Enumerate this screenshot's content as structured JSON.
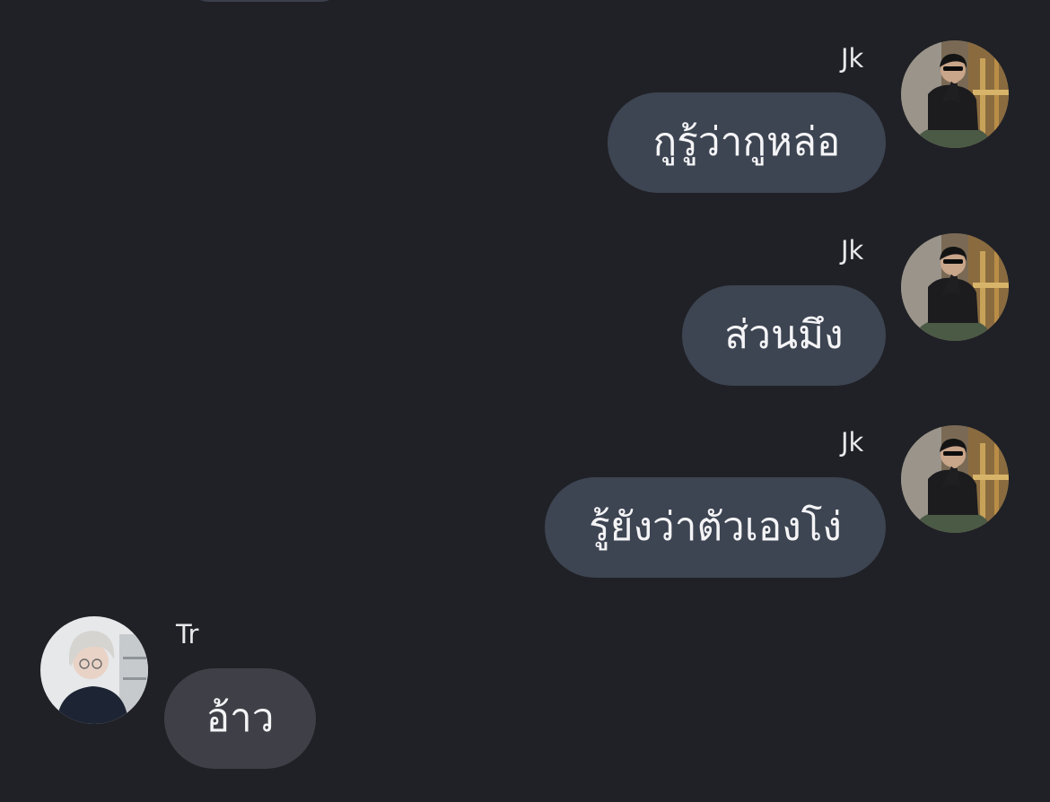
{
  "chat": {
    "messages": [
      {
        "sender": "Jk",
        "text": "กูรู้ว่ากูหล่อ",
        "direction": "outgoing",
        "avatar_icon": "jk-avatar"
      },
      {
        "sender": "Jk",
        "text": "ส่วนมึง",
        "direction": "outgoing",
        "avatar_icon": "jk-avatar"
      },
      {
        "sender": "Jk",
        "text": "รู้ยังว่าตัวเองโง่",
        "direction": "outgoing",
        "avatar_icon": "jk-avatar"
      },
      {
        "sender": "Tr",
        "text": "อ้าว",
        "direction": "incoming",
        "avatar_icon": "tr-avatar"
      }
    ]
  },
  "colors": {
    "background": "#202126",
    "outgoing_bubble": "#3d4452",
    "incoming_bubble": "#3f4047",
    "text": "#f4f4f6"
  }
}
